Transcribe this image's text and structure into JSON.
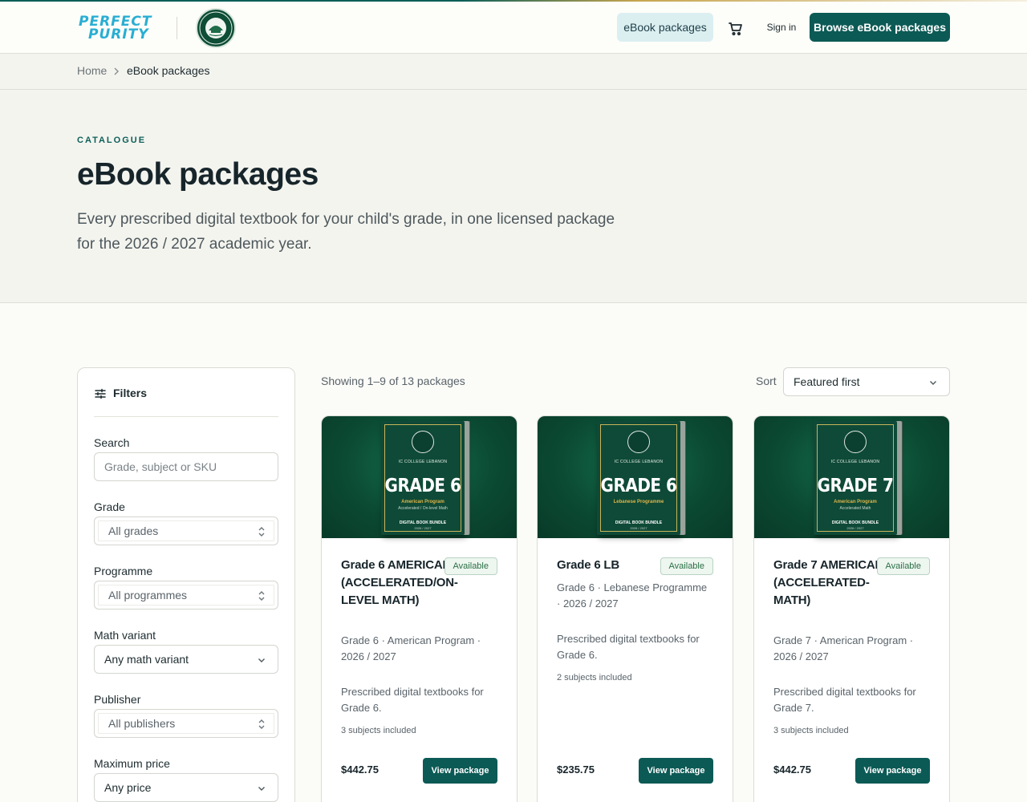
{
  "header": {
    "logo_line1": "PERFECT",
    "logo_line2": "PURITY",
    "nav_packages": "eBook packages",
    "sign_in": "Sign in",
    "browse_button": "Browse eBook packages"
  },
  "breadcrumb": {
    "home": "Home",
    "current": "eBook packages"
  },
  "hero": {
    "eyebrow": "CATALOGUE",
    "title": "eBook packages",
    "subtitle": "Every prescribed digital textbook for your child's grade, in one licensed package for the 2026 / 2027 academic year."
  },
  "filters": {
    "heading": "Filters",
    "search_label": "Search",
    "search_placeholder": "Grade, subject or SKU",
    "grade_label": "Grade",
    "grade_value": "All grades",
    "programme_label": "Programme",
    "programme_value": "All programmes",
    "math_label": "Math variant",
    "math_value": "Any math variant",
    "publisher_label": "Publisher",
    "publisher_value": "All publishers",
    "price_label": "Maximum price",
    "price_value": "Any price"
  },
  "results": {
    "showing": "Showing 1–9 of 13 packages",
    "sort_label": "Sort",
    "sort_value": "Featured first"
  },
  "cards": [
    {
      "cover_school": "IC COLLEGE LEBANON",
      "cover_grade": "GRADE 6",
      "cover_program": "American Program",
      "cover_variant": "Accelerated / On-level Math",
      "cover_bundle": "DIGITAL BOOK BUNDLE",
      "cover_year": "2026 / 2027",
      "title": "Grade 6 AMERICAN (ACCELERATED/ON-LEVEL MATH)",
      "badge": "Available",
      "meta": "Grade 6 · American Program · 2026 / 2027",
      "description": "Prescribed digital textbooks for Grade 6.",
      "subjects": "3 subjects included",
      "price": "$442.75",
      "button": "View package"
    },
    {
      "cover_school": "IC COLLEGE LEBANON",
      "cover_grade": "GRADE 6",
      "cover_program": "Lebanese Programme",
      "cover_variant": "",
      "cover_bundle": "DIGITAL BOOK BUNDLE",
      "cover_year": "2026 / 2027",
      "title": "Grade 6 LB",
      "badge": "Available",
      "meta": "Grade 6 · Lebanese Programme · 2026 / 2027",
      "description": "Prescribed digital textbooks for Grade 6.",
      "subjects": "2 subjects included",
      "price": "$235.75",
      "button": "View package"
    },
    {
      "cover_school": "IC COLLEGE LEBANON",
      "cover_grade": "GRADE 7",
      "cover_program": "American Program",
      "cover_variant": "Accelerated Math",
      "cover_bundle": "DIGITAL BOOK BUNDLE",
      "cover_year": "2026 / 2027",
      "title": "Grade 7 AMERICAN (ACCELERATED-MATH)",
      "badge": "Available",
      "meta": "Grade 7 · American Program · 2026 / 2027",
      "description": "Prescribed digital textbooks for Grade 7.",
      "subjects": "3 subjects included",
      "price": "$442.75",
      "button": "View package"
    }
  ],
  "colors": {
    "brand_teal": "#0c5a55",
    "logo_blue": "#29aed3",
    "badge_green": "#2a6f45"
  },
  "icons": [
    "shopping-cart-icon",
    "chevron-right-icon",
    "sliders-icon",
    "chevron-up-down-icon",
    "chevron-down-icon"
  ]
}
